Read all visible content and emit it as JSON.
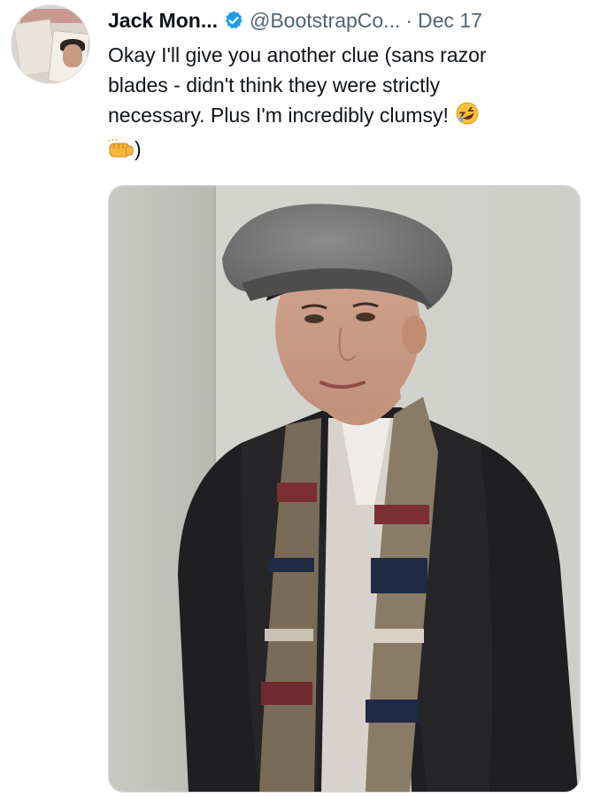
{
  "tweet": {
    "author_name": "Jack Mon...",
    "verified_icon": "verified-badge-icon",
    "handle": "@BootstrapCo...",
    "separator": "·",
    "date": "Dec 17",
    "text_lines": [
      "Okay I'll give you another clue (sans razor",
      "blades - didn't think they were strictly",
      "necessary. Plus I'm incredibly clumsy!"
    ],
    "text_tail": ")",
    "emojis": [
      "rolling-on-floor-laughing-emoji",
      "oncoming-fist-emoji"
    ],
    "media": {
      "type": "photo",
      "icon": "photo-of-person-in-flat-cap-and-scarf"
    }
  },
  "colors": {
    "text_primary": "#0f1419",
    "text_secondary": "#536471",
    "verified_blue": "#1d9bf0"
  }
}
